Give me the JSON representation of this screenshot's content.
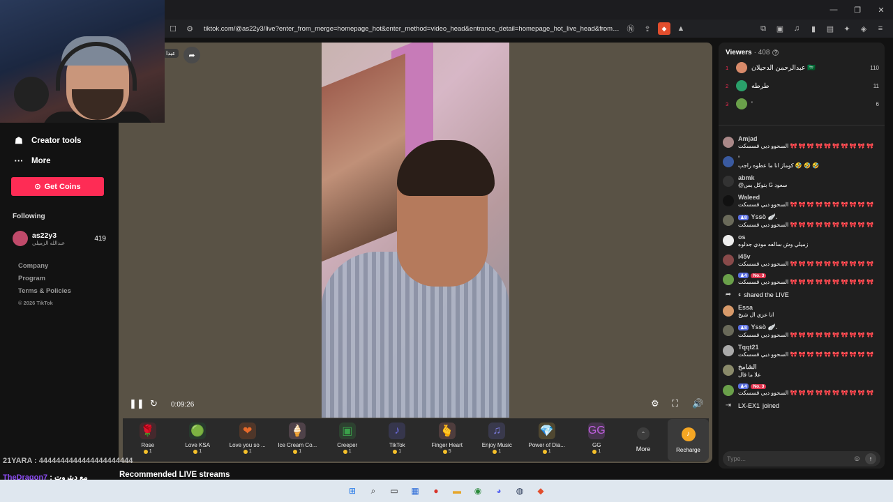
{
  "browser": {
    "url": "tiktok.com/@as22y3/live?enter_from_merge=homepage_hot&enter_method=video_head&entrance_detail=homepage_hot_live_head&from_pla...",
    "window_controls": [
      "—",
      "❐",
      "✕"
    ]
  },
  "sidebar": {
    "creator_tools": "Creator tools",
    "more": "More",
    "get_coins": "Get Coins",
    "following_label": "Following",
    "following": [
      {
        "username": "as22y3",
        "display": "عبدالله الزميلي",
        "count": "419"
      }
    ],
    "footer": [
      "Company",
      "Program",
      "Terms & Policies"
    ],
    "copyright": "© 2026 TikTok"
  },
  "stage": {
    "host_tag": "عبدا",
    "elapsed": "0:09:26"
  },
  "gifts": [
    {
      "name": "Rose",
      "cost": "1",
      "icon": "🌹",
      "color": "#b52a3a"
    },
    {
      "name": "Love KSA",
      "cost": "1",
      "icon": "🟢",
      "color": "#1e7a3a"
    },
    {
      "name": "Love you so ...",
      "cost": "1",
      "icon": "❤",
      "color": "#e86a2a"
    },
    {
      "name": "Ice Cream Co...",
      "cost": "1",
      "icon": "🍦",
      "color": "#e6a6c8"
    },
    {
      "name": "Creeper",
      "cost": "1",
      "icon": "▣",
      "color": "#3aa14a"
    },
    {
      "name": "TikTok",
      "cost": "1",
      "icon": "♪",
      "color": "#6a6ad8"
    },
    {
      "name": "Finger Heart",
      "cost": "5",
      "icon": "🫰",
      "color": "#e88a8a"
    },
    {
      "name": "Enjoy Music",
      "cost": "1",
      "icon": "♫",
      "color": "#7a7ad8"
    },
    {
      "name": "Power of Dia...",
      "cost": "1",
      "icon": "💎",
      "color": "#e6c04a"
    },
    {
      "name": "GG",
      "cost": "1",
      "icon": "GG",
      "color": "#c060e0"
    }
  ],
  "gift_more": "More",
  "recharge": "Recharge",
  "viewers": {
    "label": "Viewers",
    "count": "· 408",
    "top": [
      {
        "rank": "1",
        "name": "عبدالرحمن الدحيلان 🇸🇦",
        "score": "110",
        "color": "#d88a6a"
      },
      {
        "rank": "2",
        "name": "طرطه",
        "score": "11",
        "color": "#2aa06a"
      },
      {
        "rank": "3",
        "name": "'",
        "score": "6",
        "color": "#6aa04a"
      }
    ]
  },
  "chat": [
    {
      "user": "Amjad",
      "text": "السحوو ديي قسسكت 🎀 🎀 🎀 🎀 🎀 🎀 🎀 🎀 🎀 🎀",
      "color": "#aa8888"
    },
    {
      "user": "'",
      "text": "كوماز انا ما عطوه راجب 🤣 🤣 🤣",
      "color": "#3a5aa0"
    },
    {
      "user": "abmk",
      "text": "@بتوكل بس G سعود",
      "color": "#333"
    },
    {
      "user": "Waleed",
      "text": "السحوو ديي قسسكت 🎀 🎀 🎀 🎀 🎀 🎀 🎀 🎀 🎀 🎀",
      "color": "#111"
    },
    {
      "user": "Yssò 🪽.",
      "badge": "8",
      "text": "السحوو ديي قسسكت 🎀 🎀 🎀 🎀 🎀 🎀 🎀 🎀 🎀 🎀",
      "color": "#6a6a5a"
    },
    {
      "user": "os",
      "text": "زميلي وش سالفه مودي جدلوه",
      "color": "#eee"
    },
    {
      "user": "i45v",
      "text": "السحوو ديي قسسكت 🎀 🎀 🎀 🎀 🎀 🎀 🎀 🎀 🎀 🎀",
      "color": "#884a4a"
    },
    {
      "user": "",
      "badge": "4",
      "rank_badge": "No. 3",
      "text": "السحوو ديي قسسكت 🎀 🎀 🎀 🎀 🎀 🎀 🎀 🎀 🎀 🎀",
      "color": "#6aa04a"
    }
  ],
  "shared": {
    "user": "ء",
    "text": "shared the LIVE"
  },
  "chat2": [
    {
      "user": "Essa",
      "text": "انا عزي ال شيخ",
      "color": "#d89a6a"
    },
    {
      "user": "Yssò 🪽.",
      "badge": "8",
      "text": "السحوو ديي قسسكت 🎀 🎀 🎀 🎀 🎀 🎀 🎀 🎀 🎀 🎀",
      "color": "#6a6a5a"
    },
    {
      "user": "Tqqt21",
      "text": "السحوو ديي قسسكت 🎀 🎀 🎀 🎀 🎀 🎀 🎀 🎀 🎀 🎀",
      "color": "#aaa"
    },
    {
      "user": "الشامخ",
      "text": "علا ما قال",
      "color": "#8a8a6a"
    },
    {
      "user": "",
      "badge": "4",
      "rank_badge": "No. 3",
      "text": "السحوو ديي قسسكت 🎀 🎀 🎀 🎀 🎀 🎀 🎀 🎀 🎀 🎀",
      "color": "#6aa04a"
    }
  ],
  "joined": {
    "user": "LX-EX1",
    "text": "joined"
  },
  "chat_input": {
    "placeholder": "Type..."
  },
  "overlay": {
    "line1": "21YARA : 4444444444444444444444",
    "line2_user": "TheDragon7",
    "line2_text": ": مع ديتروت",
    "recommended": "Recommended LIVE streams"
  }
}
